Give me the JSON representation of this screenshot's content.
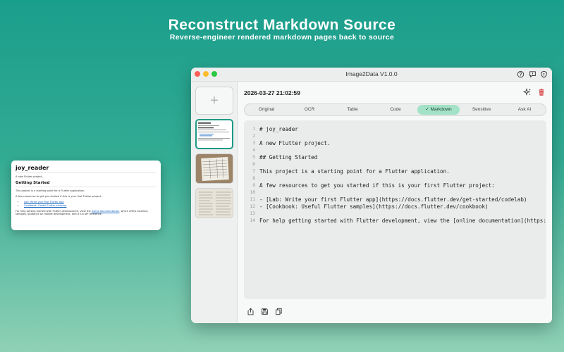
{
  "hero": {
    "title": "Reconstruct Markdown Source",
    "subtitle": "Reverse-engineer rendered markdown pages back to source"
  },
  "preview": {
    "h1": "joy_reader",
    "intro": "A new Flutter project.",
    "h2": "Getting Started",
    "p1": "This project is a starting point for a Flutter application.",
    "p2": "A few resources to get you started if this is your first Flutter project:",
    "links": [
      "Lab: Write your first Flutter app",
      "Cookbook: Useful Flutter samples"
    ],
    "p3_before": "For help getting started with Flutter development, view the ",
    "p3_link": "online documentation",
    "p3_after": ", which offers tutorials, samples, guidance on mobile development, and a full API reference."
  },
  "window": {
    "title": "Image2Data V1.0.0",
    "titlebar_icons": [
      "help-icon",
      "feedback-icon",
      "privacy-shield-icon"
    ]
  },
  "sidebar": {
    "add_label": "+",
    "thumbnails": [
      "markdown-page-thumbnail",
      "table-photo-thumbnail",
      "document-photo-thumbnail"
    ]
  },
  "main": {
    "timestamp": "2026-03-27 21:02:59",
    "actions": [
      "sparkle-ai-icon",
      "trash-icon"
    ],
    "tabs": [
      {
        "label": "Original"
      },
      {
        "label": "OCR"
      },
      {
        "label": "Table"
      },
      {
        "label": "Code"
      },
      {
        "label": "Markdown",
        "active": true
      },
      {
        "label": "Sensitive"
      },
      {
        "label": "Ask AI"
      }
    ],
    "active_check": "✓",
    "code_lines": [
      {
        "n": "1",
        "text": "# joy_reader"
      },
      {
        "n": "2",
        "text": ""
      },
      {
        "n": "3",
        "text": "A new Flutter project."
      },
      {
        "n": "4",
        "text": ""
      },
      {
        "n": "5",
        "text": "## Getting Started"
      },
      {
        "n": "6",
        "text": ""
      },
      {
        "n": "7",
        "text": "This project is a starting point for a Flutter application."
      },
      {
        "n": "8",
        "text": ""
      },
      {
        "n": "9",
        "text": "A few resources to get you started if this is your first Flutter project:"
      },
      {
        "n": "10",
        "text": ""
      },
      {
        "n": "11",
        "text": "- [Lab: Write your first Flutter app](https://docs.flutter.dev/get-started/codelab)"
      },
      {
        "n": "12",
        "text": "- [Cookbook: Useful Flutter samples](https://docs.flutter.dev/cookbook)"
      },
      {
        "n": "13",
        "text": ""
      },
      {
        "n": "14",
        "text": "For help getting started with Flutter development, view the [online documentation](https://docs"
      }
    ],
    "footer_icons": [
      "share-icon",
      "save-icon",
      "copy-icon"
    ]
  },
  "colors": {
    "accent": "#1e9a85",
    "tab_active": "#a3e2c6",
    "delete": "#d64545"
  }
}
